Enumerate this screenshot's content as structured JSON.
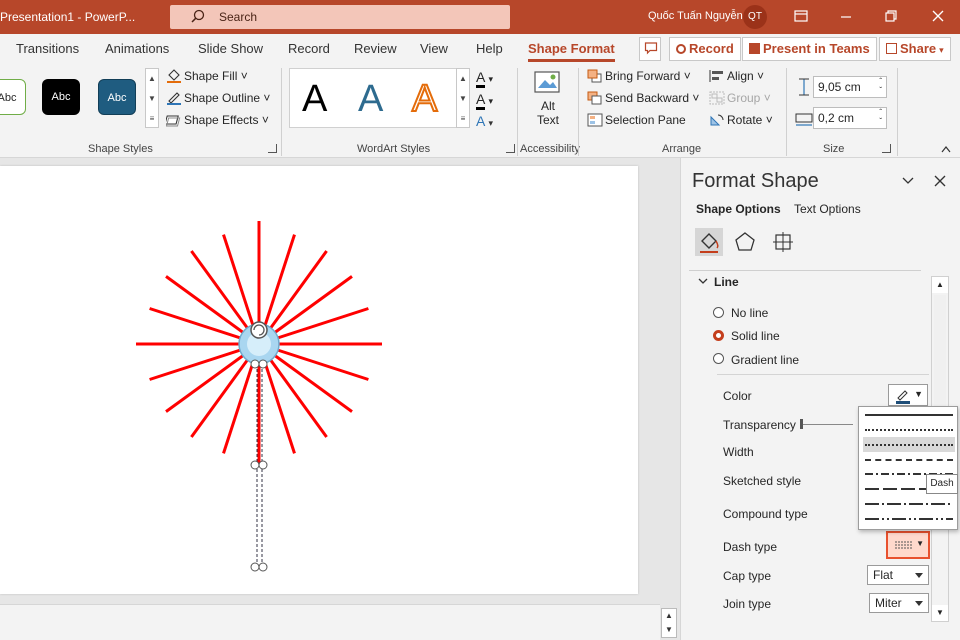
{
  "titlebar": {
    "app_title": "Presentation1  -  PowerP...",
    "search_placeholder": "Search",
    "user_name": "Quốc Tuấn Nguyễn",
    "user_initials": "QT"
  },
  "tabs": [
    "Transitions",
    "Animations",
    "Slide Show",
    "Record",
    "Review",
    "View",
    "Help",
    "Shape Format"
  ],
  "tab_actions": {
    "record": "Record",
    "present_in_teams": "Present in Teams",
    "share": "Share"
  },
  "ribbon": {
    "shape_styles": {
      "label": "Shape Styles",
      "boxes": [
        "Abc",
        "Abc",
        "Abc"
      ],
      "shape_fill": "Shape Fill",
      "shape_outline": "Shape Outline",
      "shape_effects": "Shape Effects"
    },
    "wordart": {
      "label": "WordArt Styles",
      "letter": "A"
    },
    "accessibility": {
      "label": "Accessibility",
      "alt_text_line1": "Alt",
      "alt_text_line2": "Text"
    },
    "arrange": {
      "label": "Arrange",
      "bring_forward": "Bring Forward",
      "send_backward": "Send Backward",
      "selection_pane": "Selection Pane",
      "align": "Align",
      "group": "Group",
      "rotate": "Rotate"
    },
    "size": {
      "label": "Size",
      "height": "9,05 cm",
      "width": "0,2 cm"
    }
  },
  "pane": {
    "title": "Format Shape",
    "tab_shape_options": "Shape Options",
    "tab_text_options": "Text Options",
    "section": "Line",
    "no_line": "No line",
    "solid_line": "Solid line",
    "gradient_line": "Gradient line",
    "color": "Color",
    "transparency": "Transparency",
    "width": "Width",
    "sketched": "Sketched style",
    "compound": "Compound type",
    "dash_type": "Dash type",
    "cap_type": "Cap type",
    "cap_value": "Flat",
    "join_type": "Join type",
    "join_value": "Miter"
  },
  "tooltip": "Dash",
  "colors": {
    "accent": "#b7472a",
    "star": "#ff0000",
    "selection": "#c43e1c"
  }
}
